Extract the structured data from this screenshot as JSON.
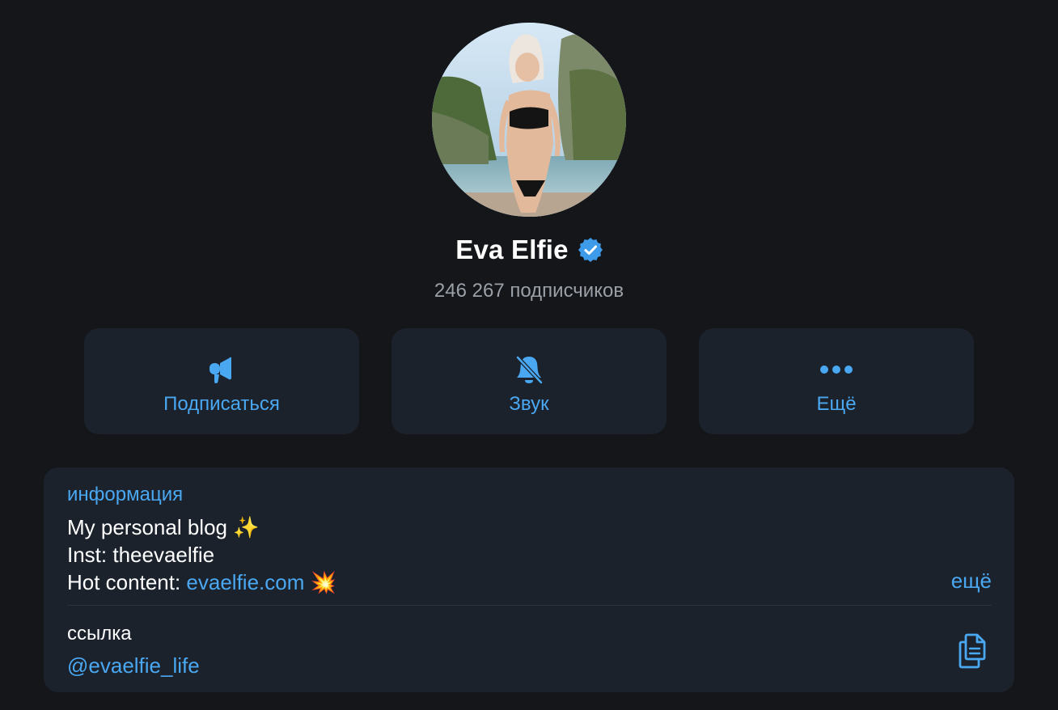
{
  "profile": {
    "name": "Eva Elfie",
    "verified_icon": "verified-badge-icon",
    "subscribers": "246 267 подписчиков",
    "avatar_icon": "channel-avatar"
  },
  "actions": {
    "subscribe_label": "Подписаться",
    "subscribe_icon": "megaphone-icon",
    "sound_label": "Звук",
    "sound_icon": "bell-muted-icon",
    "more_label": "Ещё",
    "more_icon": "more-dots-icon"
  },
  "info": {
    "title": "информация",
    "line1_text": "My personal blog ",
    "line1_emoji": "✨",
    "line2_text": "Inst: theevaelfie",
    "line3_text": "Hot content: ",
    "line3_link": "evaelfie.com",
    "line3_emoji": "💥",
    "more_label": "ещё",
    "link_label": "ссылка",
    "link_value": "@evaelfie_life",
    "copy_icon": "copy-icon"
  },
  "colors": {
    "background": "#151619",
    "card": "#1b222c",
    "accent": "#4aa7f1",
    "secondary_text": "#9aa0a8",
    "verified": "#3e9bea"
  }
}
